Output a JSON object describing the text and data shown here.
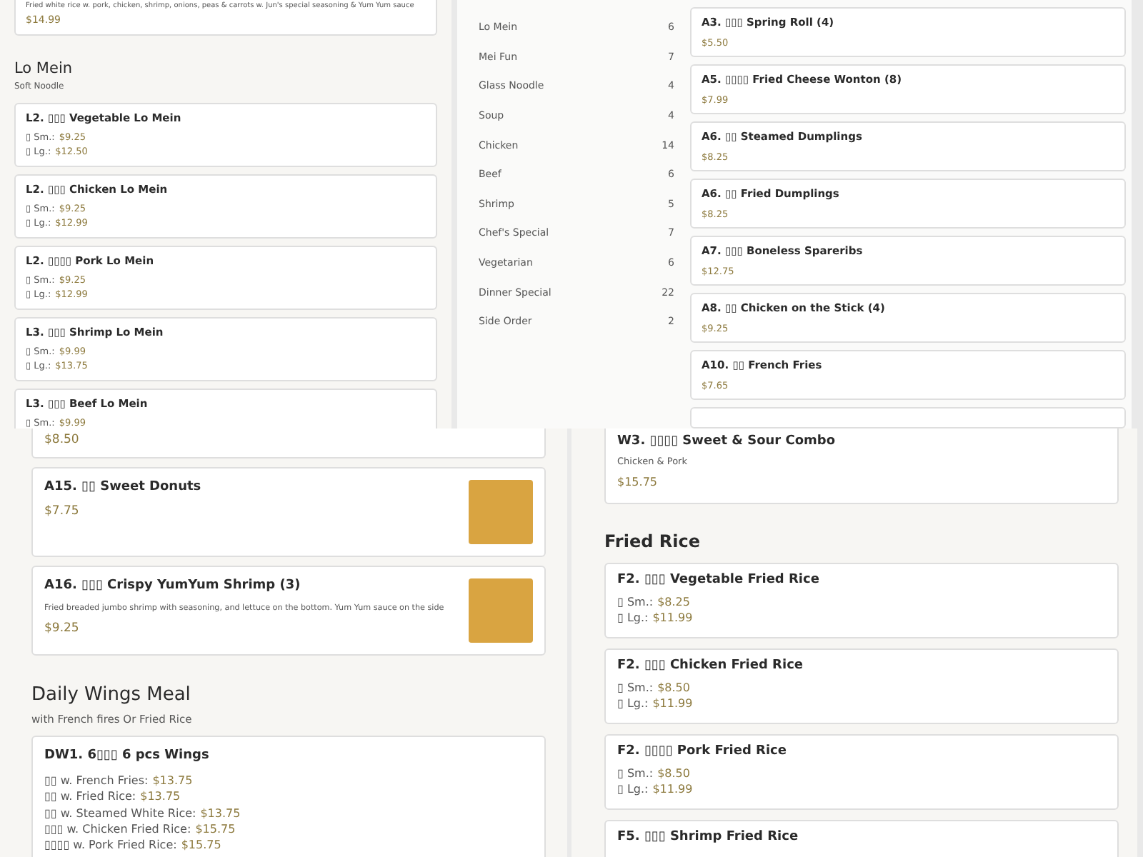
{
  "panels": [
    {
      "blocks": [
        {
          "kind": "dish",
          "description": "Fried white rice w. pork, chicken, shrimp, onions, peas & carrots w. Jun's special seasoning & Yum Yum sauce",
          "price": "$14.99"
        },
        {
          "kind": "section",
          "title": "Lo Mein",
          "subtitle": "Soft Noodle"
        },
        {
          "kind": "dish",
          "name": "L2. ▯▯▯ Vegetable Lo Mein",
          "prices": [
            {
              "label": "▯ Sm.:",
              "price": "$9.25"
            },
            {
              "label": "▯ Lg.:",
              "price": "$12.50"
            }
          ]
        },
        {
          "kind": "dish",
          "name": "L2. ▯▯▯ Chicken Lo Mein",
          "prices": [
            {
              "label": "▯ Sm.:",
              "price": "$9.25"
            },
            {
              "label": "▯ Lg.:",
              "price": "$12.99"
            }
          ]
        },
        {
          "kind": "dish",
          "name": "L2. ▯▯▯▯ Pork Lo Mein",
          "prices": [
            {
              "label": "▯ Sm.:",
              "price": "$9.25"
            },
            {
              "label": "▯ Lg.:",
              "price": "$12.99"
            }
          ]
        },
        {
          "kind": "dish",
          "name": "L3. ▯▯▯ Shrimp Lo Mein",
          "prices": [
            {
              "label": "▯ Sm.:",
              "price": "$9.99"
            },
            {
              "label": "▯ Lg.:",
              "price": "$13.75"
            }
          ]
        },
        {
          "kind": "dish",
          "name": "L3. ▯▯▯ Beef Lo Mein",
          "prices": [
            {
              "label": "▯ Sm.:",
              "price": "$9.99"
            }
          ]
        }
      ]
    },
    {
      "categories": [
        {
          "name": "Lo Mein",
          "count": "6"
        },
        {
          "name": "Mei Fun",
          "count": "7"
        },
        {
          "name": "Glass Noodle",
          "count": "4"
        },
        {
          "name": "Soup",
          "count": "4"
        },
        {
          "name": "Chicken",
          "count": "14"
        },
        {
          "name": "Beef",
          "count": "6"
        },
        {
          "name": "Shrimp",
          "count": "5"
        },
        {
          "name": "Chef's Special",
          "count": "7"
        },
        {
          "name": "Vegetarian",
          "count": "6"
        },
        {
          "name": "Dinner Special",
          "count": "22"
        },
        {
          "name": "Side Order",
          "count": "2"
        }
      ],
      "blocks": [
        {
          "kind": "dish",
          "name": "A3. ▯▯▯ Spring Roll (4)",
          "price": "$5.50"
        },
        {
          "kind": "dish",
          "name": "A5. ▯▯▯▯ Fried Cheese Wonton (8)",
          "price": "$7.99"
        },
        {
          "kind": "dish",
          "name": "A6. ▯▯ Steamed Dumplings",
          "price": "$8.25"
        },
        {
          "kind": "dish",
          "name": "A6. ▯▯ Fried Dumplings",
          "price": "$8.25"
        },
        {
          "kind": "dish",
          "name": "A7. ▯▯▯ Boneless Spareribs",
          "price": "$12.75"
        },
        {
          "kind": "dish",
          "name": "A8. ▯▯ Chicken on the Stick (4)",
          "price": "$9.25"
        },
        {
          "kind": "dish",
          "name": "A10. ▯▯ French Fries",
          "price": "$7.65"
        },
        {
          "kind": "dish"
        }
      ]
    },
    {
      "blocks": [
        {
          "kind": "dish",
          "price": "$8.50"
        },
        {
          "kind": "dish",
          "name": "A15. ▯▯ Sweet Donuts",
          "price": "$7.75",
          "photo": true
        },
        {
          "kind": "dish",
          "name": "A16. ▯▯▯ Crispy YumYum Shrimp (3)",
          "description": "Fried breaded jumbo shrimp with seasoning, and lettuce on the bottom. Yum Yum sauce on the side",
          "price": "$9.25",
          "photo": true
        },
        {
          "kind": "section",
          "title": "Daily Wings Meal",
          "subtitle": "with French fires Or Fried Rice"
        },
        {
          "kind": "dish",
          "name": "DW1. 6▯▯▯ 6 pcs Wings",
          "prices": [
            {
              "label": "▯▯ w. French Fries:",
              "price": "$13.75"
            },
            {
              "label": "▯▯ w. Fried Rice:",
              "price": "$13.75"
            },
            {
              "label": "▯▯ w. Steamed White Rice:",
              "price": "$13.75"
            },
            {
              "label": "▯▯▯ w. Chicken Fried Rice:",
              "price": "$15.75"
            },
            {
              "label": "▯▯▯▯ w. Pork Fried Rice:",
              "price": "$15.75"
            }
          ]
        }
      ]
    },
    {
      "blocks": [
        {
          "kind": "dish",
          "name": "W3. ▯▯▯▯ Sweet & Sour Combo",
          "description": "Chicken & Pork",
          "price": "$15.75"
        },
        {
          "kind": "section",
          "title": "Fried Rice"
        },
        {
          "kind": "dish",
          "name": "F2. ▯▯▯ Vegetable Fried Rice",
          "prices": [
            {
              "label": "▯ Sm.:",
              "price": "$8.25"
            },
            {
              "label": "▯ Lg.:",
              "price": "$11.99"
            }
          ]
        },
        {
          "kind": "dish",
          "name": "F2. ▯▯▯ Chicken Fried Rice",
          "prices": [
            {
              "label": "▯ Sm.:",
              "price": "$8.50"
            },
            {
              "label": "▯ Lg.:",
              "price": "$11.99"
            }
          ]
        },
        {
          "kind": "dish",
          "name": "F2. ▯▯▯▯ Pork Fried Rice",
          "prices": [
            {
              "label": "▯ Sm.:",
              "price": "$8.50"
            },
            {
              "label": "▯ Lg.:",
              "price": "$11.99"
            }
          ]
        },
        {
          "kind": "dish",
          "name": "F5. ▯▯▯ Shrimp Fried Rice"
        }
      ]
    }
  ]
}
